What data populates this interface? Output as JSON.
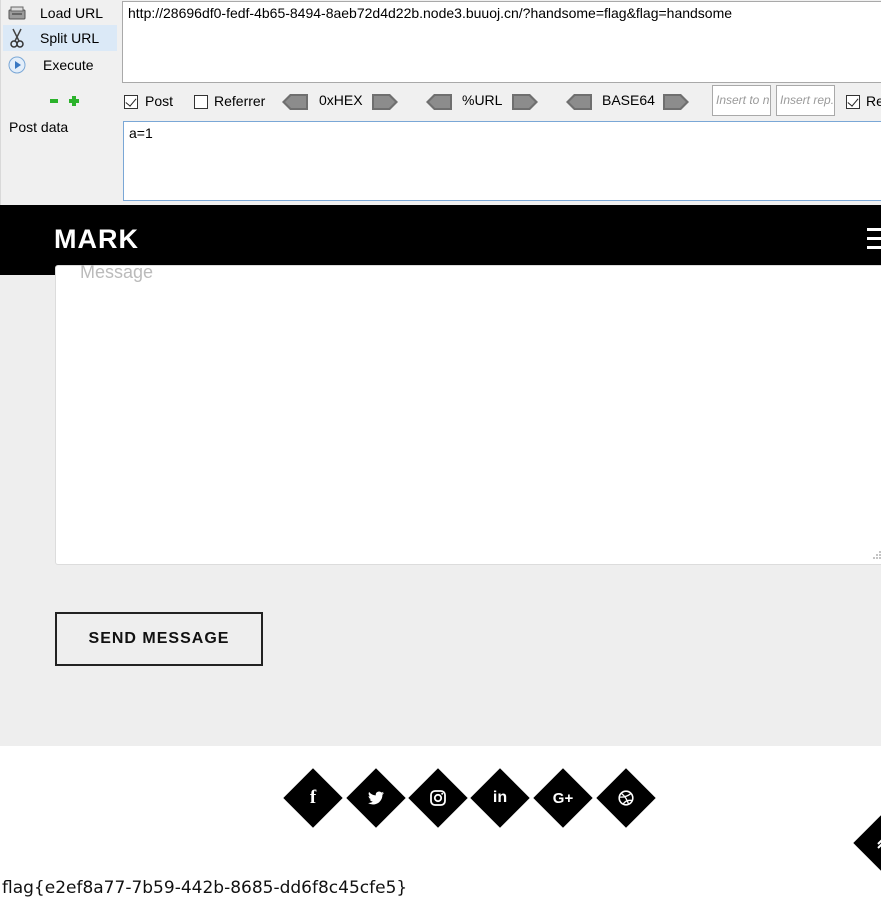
{
  "hackbar": {
    "load_url": "Load URL",
    "split_url": "Split URL",
    "execute": "Execute",
    "url_value": "http://28696df0-fedf-4b65-8494-8aeb72d4d22b.node3.buuoj.cn/?handsome=flag&flag=handsome",
    "options": {
      "post": {
        "label": "Post",
        "checked": true
      },
      "referrer": {
        "label": "Referrer",
        "checked": false
      },
      "hex": "0xHEX",
      "url": "%URL",
      "base64": "BASE64",
      "insert_to_placeholder": "Insert to n",
      "insert_rep_placeholder": "Insert rep.",
      "re": {
        "label": "Re",
        "checked": true
      }
    },
    "post_data_label": "Post data",
    "post_data_value": "a=1"
  },
  "page": {
    "logo": "MARK",
    "message_placeholder": "Message",
    "send_button": "SEND MESSAGE",
    "social": [
      "f",
      "twitter",
      "instagram",
      "in",
      "G+",
      "dribbble"
    ],
    "flag_text": "flag{e2ef8a77-7b59-442b-8685-dd6f8c45cfe5}"
  },
  "colors": {
    "nav_bg": "#000000",
    "section_bg": "#eeeeee",
    "green": "#2bb22b"
  }
}
